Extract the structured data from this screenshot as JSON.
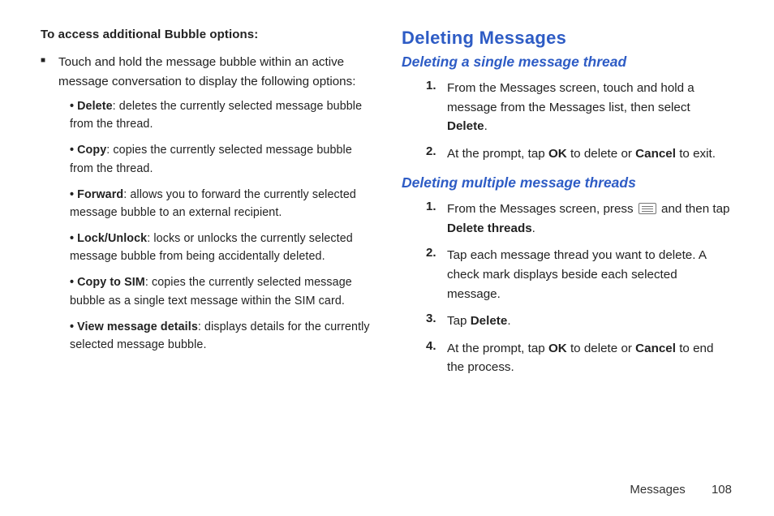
{
  "left": {
    "heading": "To access additional Bubble options:",
    "intro": "Touch and hold the message bubble within an active message conversation to display the following options:",
    "items": [
      {
        "term": "Delete",
        "desc": ": deletes the currently selected message bubble from the thread."
      },
      {
        "term": "Copy",
        "desc": ": copies the currently selected message bubble from the thread."
      },
      {
        "term": "Forward",
        "desc": ": allows you to forward the currently selected message bubble to an external recipient."
      },
      {
        "term": "Lock/Unlock",
        "desc": ": locks or unlocks the currently selected message bubble from being accidentally deleted."
      },
      {
        "term": "Copy to SIM",
        "desc": ": copies the currently selected message bubble as a single text message within the SIM card."
      },
      {
        "term": "View message details",
        "desc": ": displays details for the currently selected message bubble."
      }
    ]
  },
  "right": {
    "h2": "Deleting Messages",
    "single": {
      "h3": "Deleting a single message thread",
      "steps": [
        {
          "pre": "From the Messages screen, touch and hold a message from the Messages list, then select ",
          "b1": "Delete",
          "post": "."
        },
        {
          "pre": "At the prompt, tap ",
          "b1": "OK",
          "mid": " to delete or ",
          "b2": "Cancel",
          "post": " to exit."
        }
      ]
    },
    "multi": {
      "h3": "Deleting multiple message threads",
      "steps": [
        {
          "pre": "From the Messages screen, press ",
          "icon": true,
          "mid": " and then tap ",
          "b1": "Delete threads",
          "post": "."
        },
        {
          "pre": "Tap each message thread you want to delete. A check mark displays beside each selected message."
        },
        {
          "pre": "Tap ",
          "b1": "Delete",
          "post": "."
        },
        {
          "pre": "At the prompt, tap ",
          "b1": "OK",
          "mid": " to delete or ",
          "b2": "Cancel",
          "post": " to end the process."
        }
      ]
    }
  },
  "footer": {
    "section": "Messages",
    "page": "108"
  }
}
